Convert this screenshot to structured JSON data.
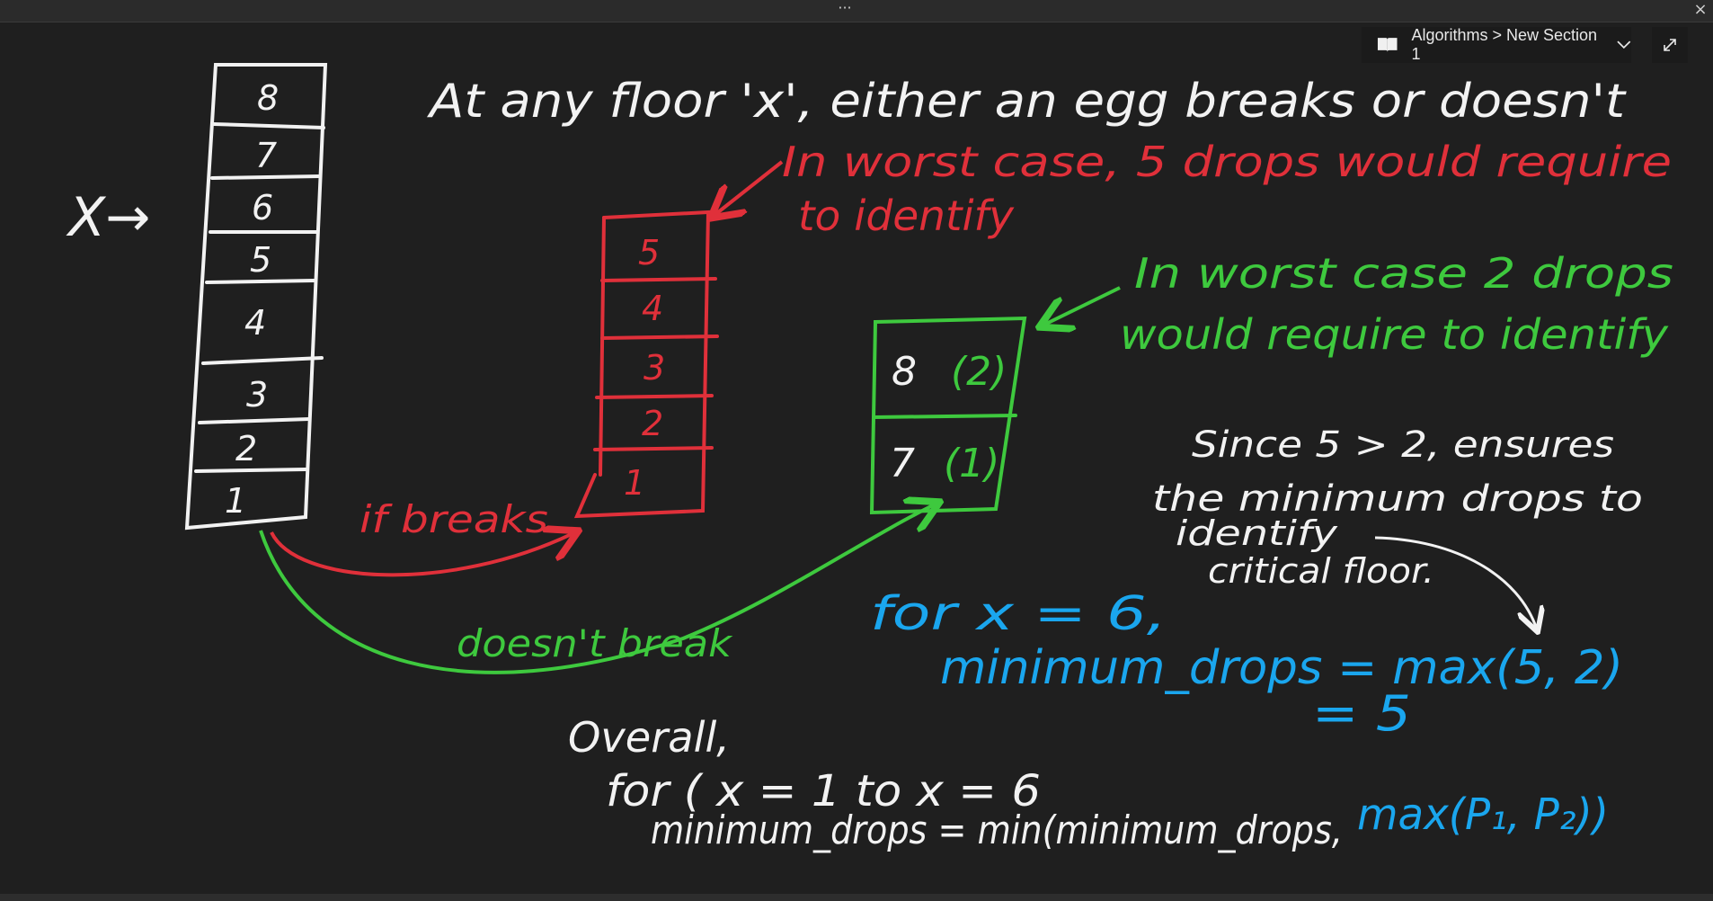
{
  "window": {
    "menu_dots": "···",
    "close_glyph": "×"
  },
  "breadcrumb": {
    "icon": "notebook-icon",
    "text": "Algorithms > New Section 1",
    "chevron_icon": "chevron-down-icon",
    "expand_icon": "expand-icon"
  },
  "colors": {
    "background": "#1f1f1f",
    "white_ink": "#f2f2f2",
    "red_ink": "#e0303a",
    "green_ink": "#3ec93e",
    "blue_ink": "#1aa6ee"
  },
  "building_white": {
    "floors": [
      "8",
      "7",
      "6",
      "5",
      "4",
      "3",
      "2",
      "1"
    ],
    "pointer_label": "X→"
  },
  "building_red": {
    "floors": [
      "5",
      "4",
      "3",
      "2",
      "1"
    ]
  },
  "building_green": {
    "floors": [
      "8",
      "7"
    ],
    "annotations": [
      "(2)",
      "(1)"
    ]
  },
  "notes": {
    "heading": "At any floor 'x', either an egg breaks or doesn't",
    "red_note_line1": "In worst case, 5 drops would require",
    "red_note_line2": "to identify",
    "green_note_line1": "In worst case 2 drops",
    "green_note_line2": "would require to identify",
    "if_breaks": "if breaks",
    "doesnt_break": "doesn't break",
    "since_line1": "Since 5 > 2, ensures",
    "since_line2": "the minimum drops to",
    "since_line3": "identify",
    "since_line4": "critical floor.",
    "for_x": "for x = 6,",
    "min_drops_eq": "minimum_drops = max(5, 2)",
    "eq_five": "= 5",
    "overall": "Overall,",
    "for_range": "for ( x = 1 to x = 6",
    "min_formula_white": "minimum_drops = min(minimum_drops,",
    "min_formula_blue": "max(P₁, P₂))"
  }
}
